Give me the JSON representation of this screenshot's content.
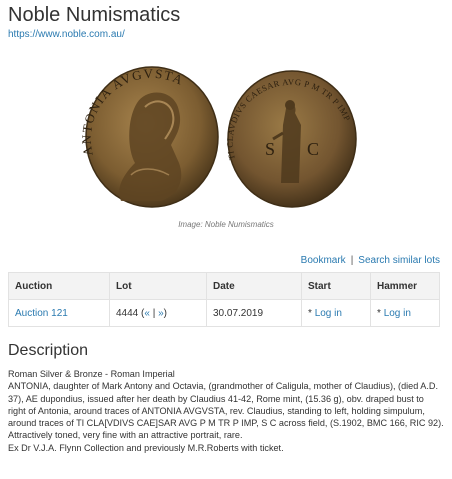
{
  "header": {
    "title": "Noble Numismatics",
    "url": "https://www.noble.com.au/"
  },
  "image": {
    "caption": "Image: Noble Numismatics",
    "obverse_legend": "ANTONIA AVGVSTA",
    "reverse_legend": "TI CLAVDIVS CAESAR AVG P M TR P IMP",
    "reverse_field": "S C"
  },
  "actions": {
    "bookmark": "Bookmark",
    "separator": "|",
    "similar": "Search similar lots"
  },
  "table": {
    "headers": [
      "Auction",
      "Lot",
      "Date",
      "Start",
      "Hammer"
    ],
    "row": {
      "auction": "Auction 121",
      "lot": "4444",
      "lot_prev": "«",
      "lot_sep": "|",
      "lot_next": "»",
      "date": "30.07.2019",
      "start": "Log in",
      "hammer": "Log in",
      "login_prefix": "*"
    }
  },
  "description": {
    "heading": "Description",
    "lines": [
      "Roman Silver & Bronze - Roman Imperial",
      "ANTONIA, daughter of Mark Antony and Octavia, (grandmother of Caligula, mother of Claudius), (died A.D. 37), AE dupondius, issued after her death by Claudius 41-42, Rome mint, (15.36 g), obv. draped bust to right of Antonia, around traces of ANTONIA AVGVSTA, rev. Claudius, standing to left, holding simpulum, around traces of TI CLA[VDIVS CAE]SAR AVG P M TR P IMP, S C across field, (S.1902, BMC 166, RIC 92). Attractively toned, very fine with an attractive portrait, rare.",
      "Ex Dr V.J.A. Flynn Collection and previously M.R.Roberts with ticket."
    ]
  },
  "colors": {
    "link": "#2a7ab0",
    "bronze": "#8a6a3a"
  }
}
